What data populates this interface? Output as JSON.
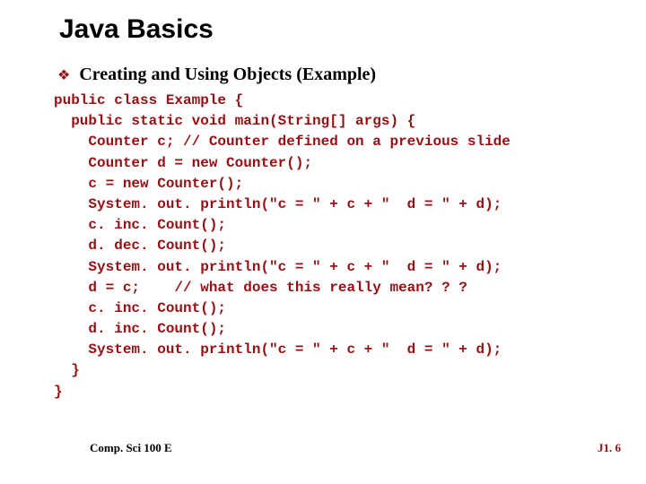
{
  "title": "Java Basics",
  "bullet": {
    "text": "Creating and Using Objects (Example)"
  },
  "code": "public class Example {\n  public static void main(String[] args) {\n    Counter c; // Counter defined on a previous slide\n    Counter d = new Counter();\n    c = new Counter();\n    System. out. println(\"c = \" + c + \"  d = \" + d);\n    c. inc. Count();\n    d. dec. Count();\n    System. out. println(\"c = \" + c + \"  d = \" + d);\n    d = c;    // what does this really mean? ? ?\n    c. inc. Count();\n    d. inc. Count();\n    System. out. println(\"c = \" + c + \"  d = \" + d);\n  }\n}",
  "footer": {
    "left": "Comp. Sci 100 E",
    "right": "J1. 6"
  }
}
